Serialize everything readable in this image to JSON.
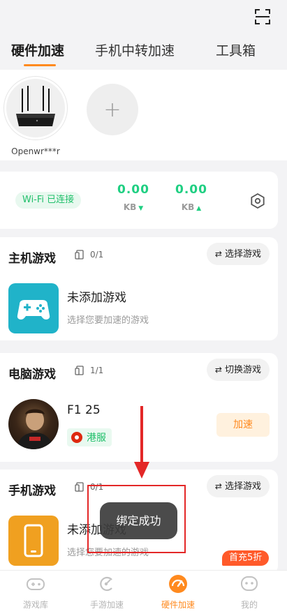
{
  "tabs": [
    {
      "label": "硬件加速",
      "active": true
    },
    {
      "label": "手机中转加速",
      "active": false
    },
    {
      "label": "工具箱",
      "active": false
    }
  ],
  "device": {
    "name": "Openwr***r",
    "add_symbol": "+"
  },
  "wifi": {
    "status": "Wi-Fi 已连接",
    "download": {
      "value": "0.00",
      "unit": "KB"
    },
    "upload": {
      "value": "0.00",
      "unit": "KB"
    }
  },
  "console_games": {
    "title": "主机游戏",
    "count": "0/1",
    "action": "选择游戏",
    "empty_title": "未添加游戏",
    "empty_subtitle": "选择您要加速的游戏"
  },
  "pc_games": {
    "title": "电脑游戏",
    "count": "1/1",
    "action": "切换游戏",
    "game_name": "F1 25",
    "region": "港服",
    "accelerate": "加速"
  },
  "mobile_games": {
    "title": "手机游戏",
    "count": "0/1",
    "action": "选择游戏",
    "empty_title": "未添加游戏",
    "empty_subtitle": "选择您要加速的游戏"
  },
  "toast": "绑定成功",
  "promo_badge": "首充5折",
  "bottom_nav": [
    {
      "label": "游戏库",
      "icon": "gamepad-icon",
      "active": false
    },
    {
      "label": "手游加速",
      "icon": "mobile-boost-icon",
      "active": false
    },
    {
      "label": "硬件加速",
      "icon": "speedometer-icon",
      "active": true
    },
    {
      "label": "我的",
      "icon": "profile-icon",
      "active": false
    }
  ],
  "colors": {
    "accent": "#ff8a1f",
    "green": "#1fcf82",
    "annotation": "#e32727"
  }
}
